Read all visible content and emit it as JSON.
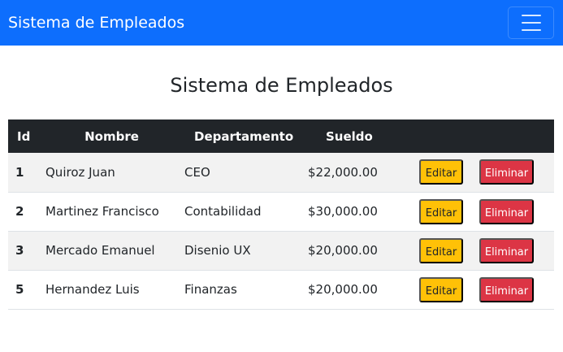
{
  "navbar": {
    "brand": "Sistema de Empleados",
    "toggler_icon": "hamburger-menu-icon"
  },
  "page": {
    "title": "Sistema de Empleados"
  },
  "table": {
    "headers": [
      "Id",
      "Nombre",
      "Departamento",
      "Sueldo",
      ""
    ],
    "rows": [
      {
        "id": "1",
        "nombre": "Quiroz Juan",
        "departamento": "CEO",
        "sueldo": "$22,000.00",
        "edit": "Editar",
        "delete": "Eliminar"
      },
      {
        "id": "2",
        "nombre": "Martinez Francisco",
        "departamento": "Contabilidad",
        "sueldo": "$30,000.00",
        "edit": "Editar",
        "delete": "Eliminar"
      },
      {
        "id": "3",
        "nombre": "Mercado Emanuel",
        "departamento": "Disenio UX",
        "sueldo": "$20,000.00",
        "edit": "Editar",
        "delete": "Eliminar"
      },
      {
        "id": "5",
        "nombre": "Hernandez Luis",
        "departamento": "Finanzas",
        "sueldo": "$20,000.00",
        "edit": "Editar",
        "delete": "Eliminar"
      }
    ]
  },
  "colors": {
    "navbar": "#0d6efd",
    "header": "#212529",
    "edit_button": "#ffc107",
    "delete_button": "#dc3545"
  }
}
